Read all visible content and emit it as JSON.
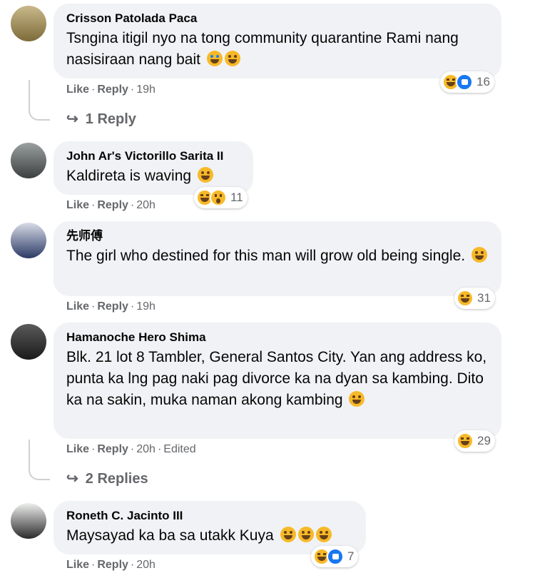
{
  "comments": [
    {
      "author": "Crisson Patolada Paca",
      "text": "Tsngina itigil nyo na tong community quarantine Rami nang nasisiraan nang bait",
      "emojis": [
        "sob",
        "laugh"
      ],
      "like": "Like",
      "reply": "Reply",
      "time": "19h",
      "edited": "",
      "reactions": [
        "haha",
        "like"
      ],
      "count": "16",
      "replies": "1 Reply"
    },
    {
      "author": "John Ar's Victorillo Sarita II",
      "text": "Kaldireta is waving",
      "emojis": [
        "laugh"
      ],
      "like": "Like",
      "reply": "Reply",
      "time": "20h",
      "edited": "",
      "reactions": [
        "haha",
        "wow"
      ],
      "count": "11",
      "replies": ""
    },
    {
      "author": "先师傅",
      "text": "The girl who destined for this man will grow old being single.",
      "emojis": [
        "smile"
      ],
      "like": "Like",
      "reply": "Reply",
      "time": "19h",
      "edited": "",
      "reactions": [
        "haha"
      ],
      "count": "31",
      "replies": ""
    },
    {
      "author": "Hamanoche Hero Shima",
      "text": "Blk. 21 lot 8 Tambler, General Santos City. Yan ang address ko, punta ka lng pag naki pag divorce ka na dyan sa kambing. Dito ka na sakin, muka naman akong kambing",
      "emojis": [
        "laugh"
      ],
      "like": "Like",
      "reply": "Reply",
      "time": "20h",
      "edited": "Edited",
      "reactions": [
        "haha"
      ],
      "count": "29",
      "replies": "2 Replies"
    },
    {
      "author": "Roneth C. Jacinto III",
      "text": "Maysayad ka ba sa utakk Kuya",
      "emojis": [
        "laugh",
        "laugh",
        "laugh"
      ],
      "like": "Like",
      "reply": "Reply",
      "time": "20h",
      "edited": "",
      "reactions": [
        "haha",
        "like"
      ],
      "count": "7",
      "replies": ""
    }
  ],
  "colors": {
    "bubble": "#f0f2f5",
    "meta": "#65676b",
    "like": "#1877f2",
    "haha": "#f7b928"
  }
}
